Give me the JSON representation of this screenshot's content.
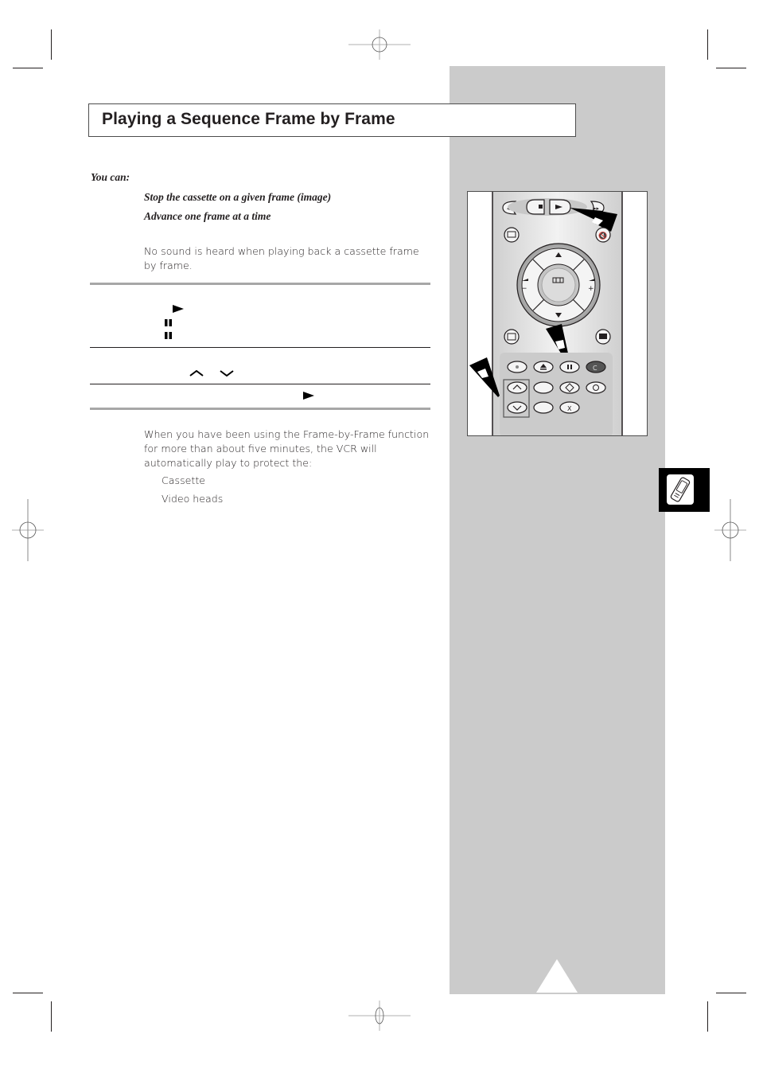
{
  "page": {
    "title": "Playing a Sequence Frame by Frame",
    "intro": {
      "lead": "You can:",
      "items": [
        "Stop the cassette on a given frame (image)",
        "Advance one frame at a time"
      ],
      "note": "No sound is heard when playing back a cassette frame by frame."
    },
    "steps": [
      {
        "icons": [
          "play-icon",
          "pause-icon",
          "pause-icon"
        ]
      },
      {
        "icons": [
          "chevron-up-icon",
          "chevron-down-icon"
        ]
      },
      {
        "icons": [
          "play-icon"
        ]
      }
    ],
    "warning": {
      "text": "When you have been using the Frame-by-Frame function for more than about five minutes, the VCR will automatically play to protect the:",
      "items": [
        "Cassette",
        "Video heads"
      ]
    }
  },
  "sidebar": {
    "remote_illustration": {
      "highlighted_buttons": [
        "play",
        "pause",
        "up-down"
      ]
    },
    "chapter_tab_icon": "remote-control-icon"
  },
  "colors": {
    "panel_grey": "#cbcbcb",
    "rule_grey": "#a7a7a7",
    "text": "#231f20",
    "tab_black": "#000000"
  }
}
